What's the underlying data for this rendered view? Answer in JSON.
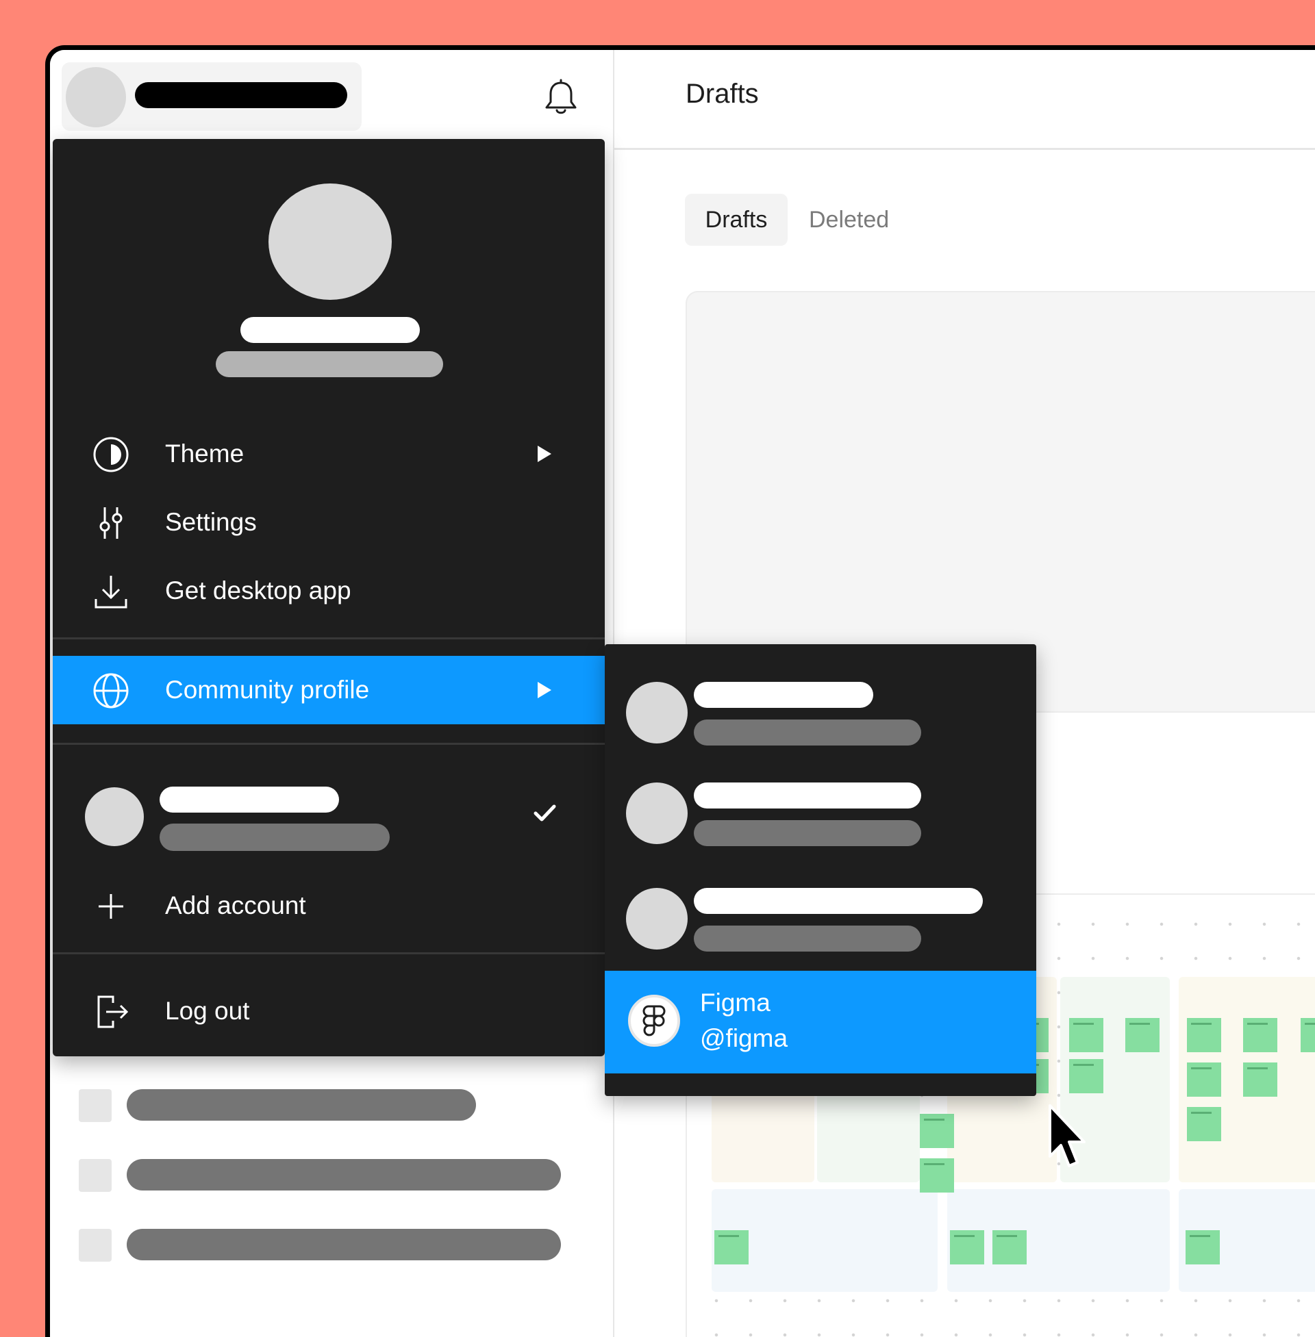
{
  "header": {
    "title": "Drafts"
  },
  "tabs": [
    {
      "label": "Drafts",
      "active": true
    },
    {
      "label": "Deleted",
      "active": false
    }
  ],
  "menu": {
    "items": [
      {
        "label": "Theme",
        "icon": "theme-icon",
        "has_submenu": true
      },
      {
        "label": "Settings",
        "icon": "sliders-icon",
        "has_submenu": false
      },
      {
        "label": "Get desktop app",
        "icon": "download-icon",
        "has_submenu": false
      },
      {
        "label": "Community profile",
        "icon": "globe-icon",
        "has_submenu": true,
        "active": true
      },
      {
        "label": "Add account",
        "icon": "plus-icon"
      },
      {
        "label": "Log out",
        "icon": "logout-icon"
      }
    ]
  },
  "submenu": {
    "profile": {
      "name": "Figma",
      "handle": "@figma",
      "icon": "figma-logo-icon"
    }
  },
  "colors": {
    "accent": "#0D99FF",
    "menu_bg": "#1E1E1E",
    "page_bg": "#FF8676",
    "sticky": "#86DEA0"
  }
}
